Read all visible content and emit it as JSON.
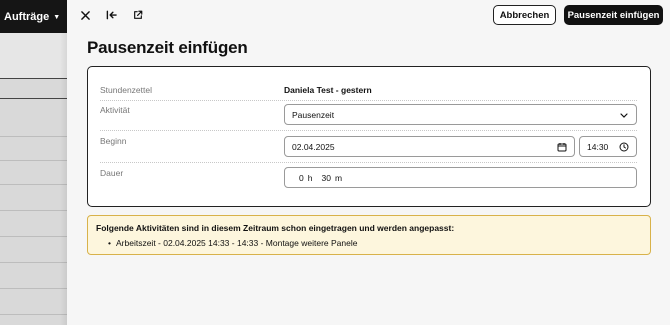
{
  "background_app": {
    "menu_label": "Aufträge"
  },
  "toolbar": {
    "cancel_label": "Abbrechen",
    "submit_label": "Pausenzeit einfügen"
  },
  "page": {
    "title": "Pausenzeit einfügen"
  },
  "form": {
    "timesheet": {
      "label": "Stundenzettel",
      "value": "Daniela Test - gestern"
    },
    "activity": {
      "label": "Aktivität",
      "selected": "Pausenzeit"
    },
    "start": {
      "label": "Beginn",
      "date": "02.04.2025",
      "time": "14:30"
    },
    "duration": {
      "label": "Dauer",
      "hours": "0",
      "hours_unit": "h",
      "minutes": "30",
      "minutes_unit": "m"
    }
  },
  "notice": {
    "title": "Folgende Aktivitäten sind in diesem Zeitraum schon eingetragen und werden angepasst:",
    "items": [
      "Arbeitszeit - 02.04.2025 14:33 - 14:33 - Montage weitere Panele"
    ]
  },
  "colors": {
    "primary": "#111111",
    "notice_bg": "#fdf6dd",
    "notice_border": "#d8b24a"
  }
}
